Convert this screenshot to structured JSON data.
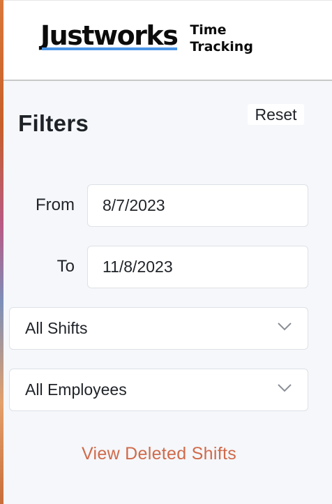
{
  "header": {
    "brand": "Justworks",
    "product_line1": "Time",
    "product_line2": "Tracking"
  },
  "filters": {
    "title": "Filters",
    "reset_label": "Reset",
    "from_label": "From",
    "from_value": "8/7/2023",
    "to_label": "To",
    "to_value": "11/8/2023",
    "shifts_select": "All Shifts",
    "employees_select": "All Employees",
    "deleted_link": "View Deleted Shifts"
  },
  "colors": {
    "brand_underline": "#4a95e6",
    "link": "#d06a4a",
    "panel_bg": "#f5f7fa"
  },
  "icons": {
    "select_arrow": "chevron-down-icon"
  }
}
